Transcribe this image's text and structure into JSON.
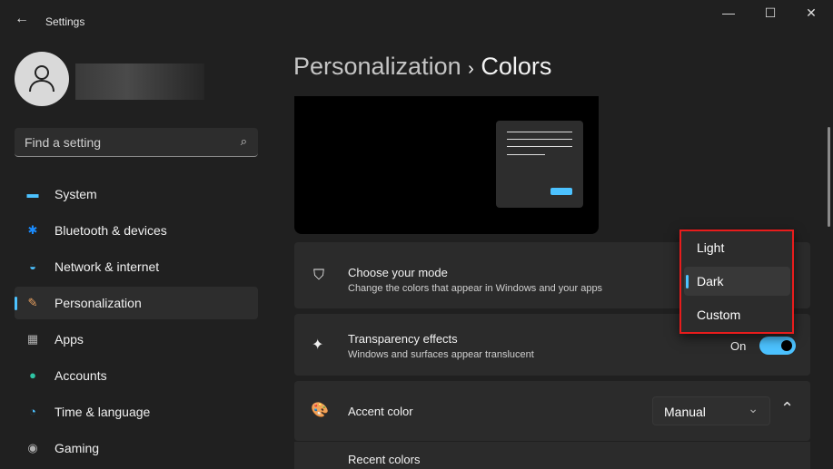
{
  "window": {
    "title": "Settings",
    "minimize": "—",
    "maximize": "☐",
    "close": "✕",
    "back": "←"
  },
  "search": {
    "placeholder": "Find a setting",
    "icon": "⌕"
  },
  "sidebar": {
    "items": [
      {
        "label": "System",
        "icon": "▬",
        "color": "#4cc2ff"
      },
      {
        "label": "Bluetooth & devices",
        "icon": "✱",
        "color": "#1a8cff"
      },
      {
        "label": "Network & internet",
        "icon": "◒",
        "color": "#4cc2ff"
      },
      {
        "label": "Personalization",
        "icon": "✎",
        "color": "#e8a060"
      },
      {
        "label": "Apps",
        "icon": "▦",
        "color": "#b0b0b0"
      },
      {
        "label": "Accounts",
        "icon": "●",
        "color": "#2ec4a4"
      },
      {
        "label": "Time & language",
        "icon": "◔",
        "color": "#4cc2ff"
      },
      {
        "label": "Gaming",
        "icon": "◉",
        "color": "#b0b0b0"
      }
    ]
  },
  "header": {
    "parent": "Personalization",
    "sep": "›",
    "current": "Colors"
  },
  "cards": {
    "mode": {
      "title": "Choose your mode",
      "subtitle": "Change the colors that appear in Windows and your apps",
      "icon": "⛉"
    },
    "transparency": {
      "title": "Transparency effects",
      "subtitle": "Windows and surfaces appear translucent",
      "state": "On",
      "icon": "✦"
    },
    "accent": {
      "title": "Accent color",
      "value": "Manual",
      "icon": "🎨",
      "chevron": "⌄",
      "collapse": "⌃"
    },
    "recent": {
      "title": "Recent colors"
    }
  },
  "mode_menu": {
    "options": [
      "Light",
      "Dark",
      "Custom"
    ],
    "selected": "Dark"
  }
}
